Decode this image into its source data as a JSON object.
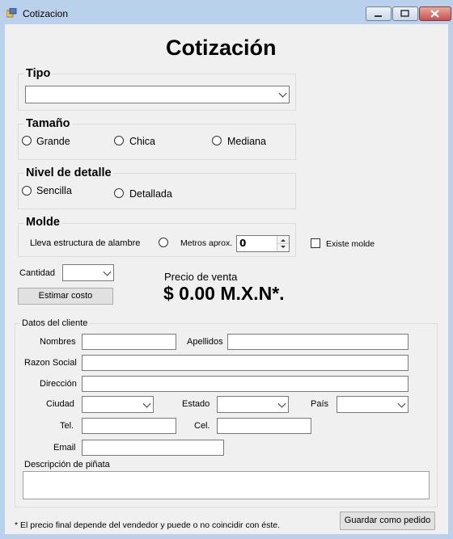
{
  "window": {
    "title": "Cotizacion"
  },
  "form": {
    "title": "Cotización",
    "tipo": {
      "heading": "Tipo",
      "value": ""
    },
    "tamano": {
      "heading": "Tamaño",
      "options": [
        "Grande",
        "Chica",
        "Mediana"
      ]
    },
    "nivel": {
      "heading": "Nivel de detalle",
      "options": [
        "Sencilla",
        "Detallada"
      ]
    },
    "molde": {
      "heading": "Molde",
      "wire_label": "Lleva estructura de alambre",
      "meters_label": "Metros aprox.",
      "meters_value": "0",
      "existe_label": "Existe molde"
    },
    "cantidad": {
      "label": "Cantidad",
      "value": ""
    },
    "estimate_button": "Estimar costo",
    "price": {
      "label": "Precio de venta",
      "value": "$ 0.00 M.X.N*."
    },
    "cliente": {
      "heading": "Datos del cliente",
      "nombres": "Nombres",
      "apellidos": "Apellidos",
      "razon": "Razon Social",
      "direccion": "Dirección",
      "ciudad": "Ciudad",
      "estado": "Estado",
      "pais": "País",
      "tel": "Tel.",
      "cel": "Cel.",
      "email": "Email",
      "descripcion": "Descripción de piñata"
    },
    "footnote": "* El precio final depende del vendedor y puede o no coincidir con éste.",
    "save_button": "Guardar como pedido"
  }
}
